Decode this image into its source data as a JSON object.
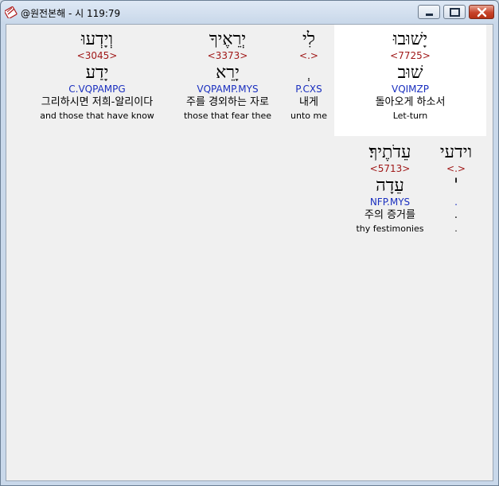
{
  "window": {
    "title": "@원전본해 - 시 119:79",
    "controls": {
      "minimize_icon": "minimize-icon",
      "maximize_icon": "maximize-icon",
      "close_icon": "close-icon"
    },
    "app_icon": "bible-app-icon"
  },
  "colors": {
    "strong": "#a01818",
    "morph": "#1a2fbf",
    "highlight_bg": "#ffffff",
    "client_bg": "#f0f0f0"
  },
  "words": [
    {
      "hebrew": "יָשׁוּבוּ",
      "strong": "<7725>",
      "lemma": "שׁוּב",
      "morph": "VQIMZP",
      "korean": "돌아오게 하소서",
      "english": "Let-turn",
      "selected": true
    },
    {
      "hebrew": "לִי",
      "strong": "<.>",
      "lemma": "ְ",
      "morph": "P.CXS",
      "korean": "내게",
      "english": "unto me",
      "selected": false
    },
    {
      "hebrew": "יְרֵאֶיךָ",
      "strong": "<3373>",
      "lemma": "יָרֵא",
      "morph": "VQPAMP.MYS",
      "korean": "주를 경외하는 자로",
      "english": "those that fear thee",
      "selected": false
    },
    {
      "hebrew": "וְיָדְעוּ",
      "strong": "<3045>",
      "lemma": "יָדַע",
      "morph": "C.VQPAMPG",
      "korean": "그리하시면 저희-알리이다",
      "english": "and those that have know",
      "selected": false
    },
    {
      "hebrew": "וידעי",
      "strong": "<.>",
      "lemma": "'",
      "morph": ".",
      "korean": ".",
      "english": ".",
      "selected": false
    },
    {
      "hebrew": "עֵדֹתֶיךָ׃",
      "strong": "<5713>",
      "lemma": "עֵדָה",
      "morph": "NFP.MYS",
      "korean": "주의 증거를",
      "english": "thy festimonies",
      "selected": false
    }
  ]
}
